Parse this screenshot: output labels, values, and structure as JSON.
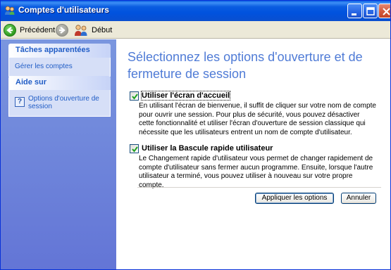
{
  "window": {
    "title": "Comptes d'utilisateurs",
    "title_icon": "users-icon",
    "controls": [
      "minimize",
      "maximize",
      "close"
    ]
  },
  "toolbar": {
    "back_label": "Précédent",
    "home_label": "Début"
  },
  "sidebar": {
    "related_tasks_title": "Tâches apparentées",
    "related_tasks": [
      "Gérer les comptes"
    ],
    "help_title": "Aide sur",
    "help_items": [
      "Options d'ouverture de session"
    ]
  },
  "main": {
    "heading": "Sélectionnez les options d'ouverture et de fermeture de session",
    "options": [
      {
        "label": "Utiliser l'écran d'accueil",
        "checked": true,
        "description": "En utilisant l'écran de bienvenue, il suffit de cliquer sur votre nom de compte pour ouvrir une session. Pour plus de sécurité, vous pouvez désactiver cette fonctionnalité et utiliser l'écran d'ouverture de session classique qui nécessite que les utilisateurs entrent un nom de compte d'utilisateur."
      },
      {
        "label": "Utiliser la Bascule rapide utilisateur",
        "checked": true,
        "description": "Le Changement rapide d'utilisateur vous permet de changer rapidement de compte d'utilisateur sans fermer aucun programme. Ensuite, lorsque l'autre utilisateur a terminé, vous pouvez utiliser à nouveau sur votre propre compte."
      }
    ],
    "apply_label": "Appliquer les options",
    "cancel_label": "Annuler"
  },
  "colors": {
    "titlebar": "#0A5CE0",
    "sidebar": "#7A96DF",
    "heading": "#4F7BD6",
    "link": "#215DC6"
  }
}
